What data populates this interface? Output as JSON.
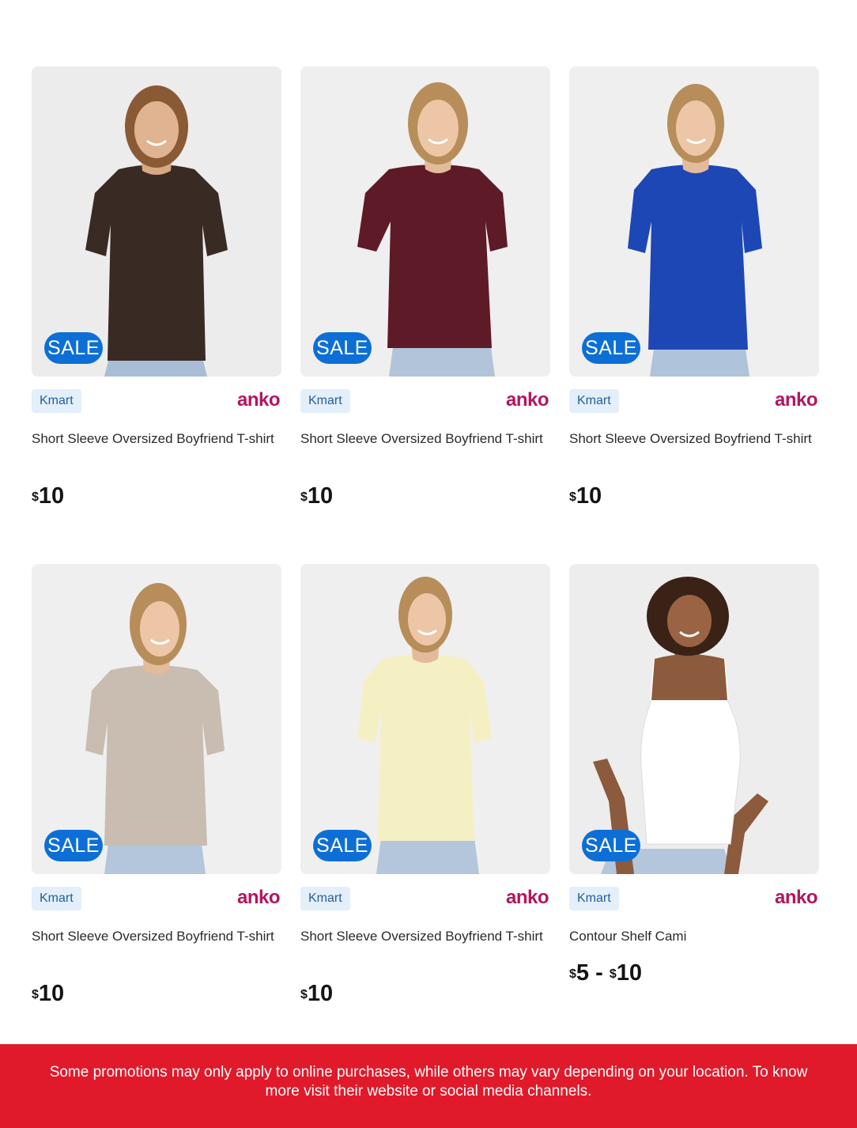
{
  "products": [
    {
      "badge": "SALE",
      "store": "Kmart",
      "brand": "anko",
      "title": "Short Sleeve Oversized Boyfriend T-shirt",
      "price_currency": "$",
      "price_amount": "10",
      "shirt_color": "#3a2a24"
    },
    {
      "badge": "SALE",
      "store": "Kmart",
      "brand": "anko",
      "title": "Short Sleeve Oversized Boyfriend T-shirt",
      "price_currency": "$",
      "price_amount": "10",
      "shirt_color": "#5e1a27"
    },
    {
      "badge": "SALE",
      "store": "Kmart",
      "brand": "anko",
      "title": "Short Sleeve Oversized Boyfriend T-shirt",
      "price_currency": "$",
      "price_amount": "10",
      "shirt_color": "#1d47b5"
    },
    {
      "badge": "SALE",
      "store": "Kmart",
      "brand": "anko",
      "title": "Short Sleeve Oversized Boyfriend T-shirt",
      "price_currency": "$",
      "price_amount": "10",
      "shirt_color": "#c9bcb0"
    },
    {
      "badge": "SALE",
      "store": "Kmart",
      "brand": "anko",
      "title": "Short Sleeve Oversized Boyfriend T-shirt",
      "price_currency": "$",
      "price_amount": "10",
      "shirt_color": "#f5f0c4"
    },
    {
      "badge": "SALE",
      "store": "Kmart",
      "brand": "anko",
      "title": "Contour Shelf Cami",
      "price_currency": "$",
      "price_amount": "5",
      "price_separator": "-",
      "price_currency_max": "$",
      "price_amount_max": "10",
      "shirt_color": "#ffffff"
    }
  ],
  "footer": {
    "text": "Some promotions may only apply to online purchases, while others may vary depending on your location. To know more visit their website or social media channels."
  },
  "colors": {
    "sale_badge": "#0d6fd6",
    "store_tag_bg": "#e3effa",
    "brand": "#b3155f",
    "footer_bg": "#e01a2b"
  }
}
